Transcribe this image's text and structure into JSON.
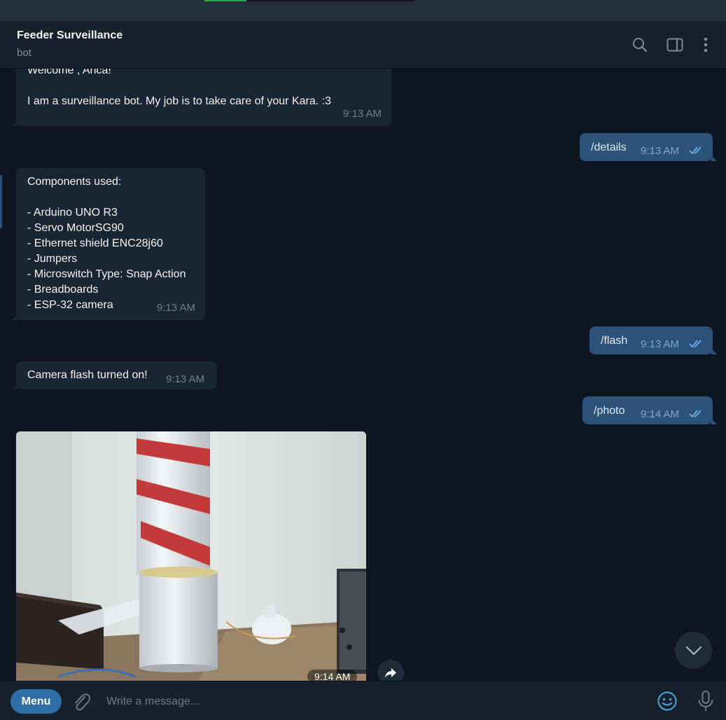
{
  "header": {
    "title": "Feeder Surveillance",
    "subtitle": "bot",
    "icons": [
      "search-icon",
      "sidebar-toggle-icon",
      "more-vertical-icon"
    ]
  },
  "messages": [
    {
      "dir": "in",
      "lines": [
        "Welcome , Anca!",
        "",
        "I am a surveillance bot. My job is to take care of your Kara. :3"
      ],
      "time": "9:13 AM"
    },
    {
      "dir": "out",
      "text": "/details",
      "time": "9:13 AM",
      "status": "read"
    },
    {
      "dir": "in",
      "lines": [
        "Components used:",
        "",
        "- Arduino UNO R3",
        "- Servo MotorSG90",
        "- Ethernet shield ENC28j60",
        "- Jumpers",
        "- Microswitch Type: Snap Action",
        "- Breadboards",
        "- ESP-32 camera"
      ],
      "time": "9:13 AM"
    },
    {
      "dir": "out",
      "text": "/flash",
      "time": "9:13 AM",
      "status": "read"
    },
    {
      "dir": "in",
      "text": "Camera flash turned on!",
      "time": "9:13 AM"
    },
    {
      "dir": "out",
      "text": "/photo",
      "time": "9:14 AM",
      "status": "read"
    },
    {
      "dir": "in",
      "type": "photo",
      "time": "9:14 AM"
    }
  ],
  "composer": {
    "menu_label": "Menu",
    "placeholder": "Write a message..."
  },
  "colors": {
    "background": "#0e1621",
    "header": "#17212b",
    "incoming_bubble": "#182533",
    "outgoing_bubble": "#2b5278",
    "accent": "#2f6ea5"
  }
}
